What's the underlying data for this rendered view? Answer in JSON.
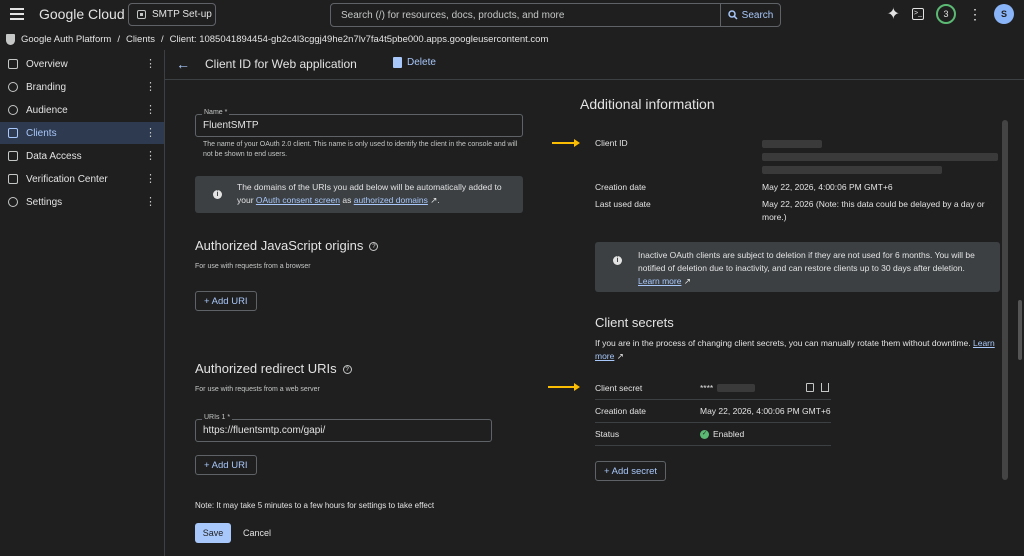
{
  "topbar": {
    "brand": "Google Cloud",
    "project": "SMTP Set-up",
    "search_placeholder": "Search (/) for resources, docs, products, and more",
    "search_button": "Search",
    "notification_count": "3",
    "avatar_initial": "S"
  },
  "breadcrumb": {
    "root": "Google Auth Platform",
    "sep1": "/",
    "clients": "Clients",
    "sep2": "/",
    "current": "Client: 1085041894454-gb2c4l3cggj49he2n7lv7fa4t5pbe000.apps.googleusercontent.com"
  },
  "sidebar": {
    "items": [
      {
        "label": "Overview",
        "icon": "grid-icon"
      },
      {
        "label": "Branding",
        "icon": "palette-icon"
      },
      {
        "label": "Audience",
        "icon": "person-icon"
      },
      {
        "label": "Clients",
        "icon": "key-icon",
        "active": true
      },
      {
        "label": "Data Access",
        "icon": "data-icon"
      },
      {
        "label": "Verification Center",
        "icon": "check-icon"
      },
      {
        "label": "Settings",
        "icon": "gear-icon"
      }
    ]
  },
  "header": {
    "title": "Client ID for Web application",
    "delete_label": "Delete"
  },
  "form": {
    "name_label": "Name *",
    "name_value": "FluentSMTP",
    "name_hint": "The name of your OAuth 2.0 client. This name is only used to identify the client in the console and will not be shown to end users.",
    "info_text_1": "The domains of the URIs you add below will be automatically added to your ",
    "info_link_1": "OAuth consent screen",
    "info_text_2": " as ",
    "info_link_2": "authorized domains",
    "info_text_3": ".",
    "js_origins_title": "Authorized JavaScript origins",
    "js_origins_sub": "For use with requests from a browser",
    "add_uri_label": "+ Add URI",
    "redirect_title": "Authorized redirect URIs",
    "redirect_sub": "For use with requests from a web server",
    "uri_label": "URIs 1 *",
    "uri_value": "https://fluentsmtp.com/gapi/",
    "add_uri_label_2": "+ Add URI",
    "note": "Note: It may take 5 minutes to a few hours for settings to take effect",
    "save": "Save",
    "cancel": "Cancel"
  },
  "additional": {
    "title": "Additional information",
    "client_id_label": "Client ID",
    "creation_date_label": "Creation date",
    "creation_date_value": "May 22, 2026, 4:00:06 PM GMT+6",
    "last_used_label": "Last used date",
    "last_used_value": "May 22, 2026 (Note: this data could be delayed by a day or more.)",
    "inactive_text": "Inactive OAuth clients are subject to deletion if they are not used for 6 months. You will be notified of deletion due to inactivity, and can restore clients up to 30 days after deletion. ",
    "learn_more": "Learn more"
  },
  "secrets": {
    "title": "Client secrets",
    "desc": "If you are in the process of changing client secrets, you can manually rotate them without downtime. ",
    "learn_more": "Learn more",
    "secret_label": "Client secret",
    "secret_value": "****",
    "creation_label": "Creation date",
    "creation_value": "May 22, 2026, 4:00:06 PM GMT+6",
    "status_label": "Status",
    "status_value": "Enabled",
    "add_secret": "+ Add secret"
  },
  "colors": {
    "background": "#1f1f1f",
    "accent": "#a8c7fa",
    "arrow": "#fbbc04",
    "enabled": "#5bb974"
  }
}
